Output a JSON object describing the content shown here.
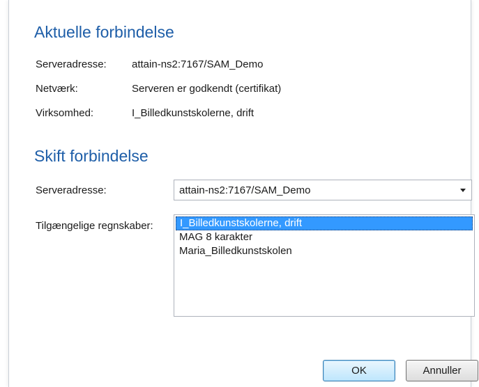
{
  "current": {
    "title": "Aktuelle forbindelse",
    "server_label": "Serveradresse:",
    "server_value": "attain-ns2:7167/SAM_Demo",
    "network_label": "Netværk:",
    "network_value": "Serveren er godkendt (certifikat)",
    "company_label": "Virksomhed:",
    "company_value": "I_Billedkunstskolerne, drift"
  },
  "switch": {
    "title": "Skift forbindelse",
    "server_label": "Serveradresse:",
    "server_selected": "attain-ns2:7167/SAM_Demo",
    "accounts_label": "Tilgængelige regnskaber:",
    "accounts": [
      "I_Billedkunstskolerne, drift",
      "MAG 8 karakter",
      "Maria_Billedkunstskolen"
    ],
    "selected_account": "I_Billedkunstskolerne, drift"
  },
  "buttons": {
    "ok": "OK",
    "cancel": "Annuller"
  }
}
